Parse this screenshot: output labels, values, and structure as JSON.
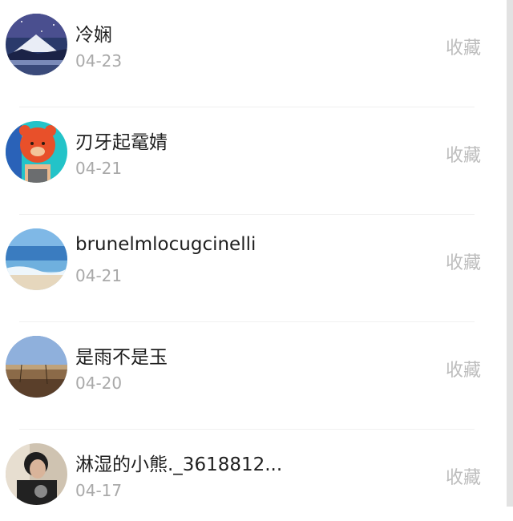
{
  "favorites": {
    "items": [
      {
        "name": "冷娴",
        "date": "04-23",
        "action": "收藏"
      },
      {
        "name": "刃牙起鼋婧",
        "date": "04-21",
        "action": "收藏"
      },
      {
        "name": "brunelmlocugcinelli",
        "date": "04-21",
        "action": "收藏"
      },
      {
        "name": "是雨不是玉",
        "date": "04-20",
        "action": "收藏"
      },
      {
        "name": "淋湿的小熊._3618812...",
        "date": "04-17",
        "action": "收藏"
      }
    ]
  }
}
